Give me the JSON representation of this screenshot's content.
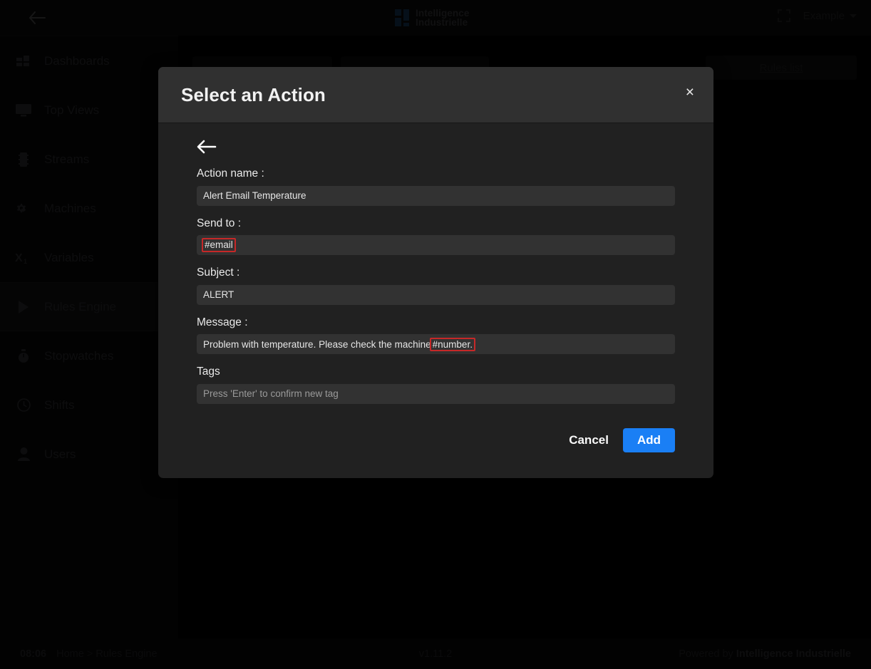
{
  "topbar": {
    "back_icon": "arrow-left-icon",
    "brand_line1": "Intelligence",
    "brand_line2": "Industrielle",
    "fullscreen_icon": "fullscreen-icon",
    "account_label": "Example",
    "caret_icon": "chevron-down-icon"
  },
  "sidebar": {
    "items": [
      {
        "label": "Dashboards",
        "icon": "dashboard-icon",
        "active": false
      },
      {
        "label": "Top Views",
        "icon": "monitor-icon",
        "active": false
      },
      {
        "label": "Streams",
        "icon": "chip-icon",
        "active": false
      },
      {
        "label": "Machines",
        "icon": "gears-icon",
        "active": false
      },
      {
        "label": "Variables",
        "icon": "variable-x-icon",
        "active": false
      },
      {
        "label": "Rules Engine",
        "icon": "play-icon",
        "active": true
      },
      {
        "label": "Stopwatches",
        "icon": "stopwatch-icon",
        "active": false
      },
      {
        "label": "Shifts",
        "icon": "clock-icon",
        "active": false
      },
      {
        "label": "Users",
        "icon": "user-icon",
        "active": false
      }
    ]
  },
  "content": {
    "rules_list_link": "Rules list"
  },
  "modal": {
    "title": "Select an Action",
    "close_label": "×",
    "back_icon": "arrow-left-icon",
    "fields": {
      "action_name_label": "Action name :",
      "action_name_value": "Alert Email Temperature",
      "send_to_label": "Send to :",
      "send_to_token": "#email",
      "subject_label": "Subject :",
      "subject_value": "ALERT",
      "message_label": "Message :",
      "message_text": "Problem with temperature. Please check the machine ",
      "message_token": "#number.",
      "tags_label": "Tags",
      "tags_placeholder": "Press 'Enter' to confirm new tag"
    },
    "cancel_label": "Cancel",
    "add_label": "Add",
    "accent_color": "#1a7ff5",
    "error_color": "#c62828"
  },
  "footer": {
    "time": "08:06",
    "crumb_home": "Home",
    "crumb_sep": ">",
    "crumb_current": "Rules Engine",
    "version": "v1.11.2",
    "powered_by": "Powered by ",
    "powered_brand": "Intelligence Industrielle"
  }
}
